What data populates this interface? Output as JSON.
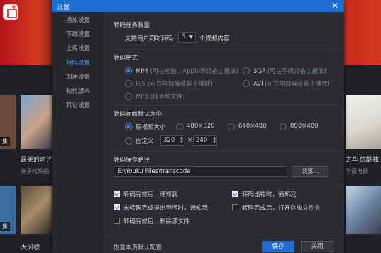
{
  "background": {
    "overlay_caption_1": "集",
    "overlay_caption_2": "集",
    "row1_titles": [
      "最美的时光",
      "之华",
      "优酷独"
    ],
    "row1_subtitles": [
      "亲子代系相",
      "华语电影"
    ],
    "row2_titles": [
      "大风歌"
    ]
  },
  "dialog": {
    "title": "设置",
    "close_label": "✕",
    "sidebar": [
      {
        "label": "播放设置",
        "active": false
      },
      {
        "label": "下载设置",
        "active": false
      },
      {
        "label": "上传设置",
        "active": false
      },
      {
        "label": "转码设置",
        "active": true
      },
      {
        "label": "加速设置",
        "active": false
      },
      {
        "label": "软件版本",
        "active": false
      },
      {
        "label": "其它设置",
        "active": false
      }
    ],
    "task_count": {
      "section_title": "转码任务数量",
      "prefix": "支持用户同时转码",
      "value": "3",
      "suffix": "个视频内容"
    },
    "format": {
      "section_title": "转码格式",
      "options": [
        {
          "label": "MP4",
          "hint": "(可在电脑、Apple等设备上播放)",
          "selected": true,
          "enabled": true
        },
        {
          "label": "3GP",
          "hint": "(可在手机设备上播放)",
          "selected": false,
          "enabled": true
        },
        {
          "label": "FLV",
          "hint": "(可在电脑等设备上播放)",
          "selected": false,
          "enabled": false
        },
        {
          "label": "AVI",
          "hint": "(可在电脑等设备上播放)",
          "selected": false,
          "enabled": true
        },
        {
          "label": "MP3",
          "hint": "(纯音频文件)",
          "selected": false,
          "enabled": false
        }
      ]
    },
    "size": {
      "section_title": "转码画面默认大小",
      "options": [
        {
          "label": "原视频大小",
          "selected": true
        },
        {
          "label": "480×320",
          "selected": false
        },
        {
          "label": "640×480",
          "selected": false
        },
        {
          "label": "800×480",
          "selected": false
        }
      ],
      "custom_label": "自定义",
      "width": "320",
      "times": "×",
      "height": "240"
    },
    "save_path": {
      "section_title": "转码保存路径",
      "value": "E:\\Youku Files\\transcode",
      "browse_label": "浏览..."
    },
    "checks": [
      {
        "label": "转码完成后，通知我",
        "checked": true
      },
      {
        "label": "转码出错时，通知我",
        "checked": true
      },
      {
        "label": "未转码完成退出程序时，通知我",
        "checked": true
      },
      {
        "label": "转码完成后，打开存放文件夹",
        "checked": false
      },
      {
        "label": "转码完成后，删除源文件",
        "checked": false
      }
    ],
    "footer": {
      "restore_label": "恢复本页默认配置",
      "save_label": "保存",
      "close_label": "关闭"
    }
  },
  "colors": {
    "accent": "#1e6fd1",
    "dialog_bg": "#2b2c31",
    "sidebar_bg": "#26272b"
  }
}
